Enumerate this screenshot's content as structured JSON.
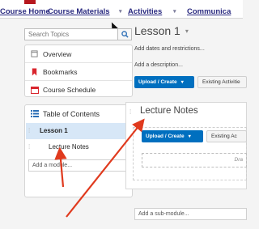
{
  "nav": {
    "items": [
      {
        "label": "Course Home",
        "has_menu": false
      },
      {
        "label": "Course Materials",
        "has_menu": true
      },
      {
        "label": "Activities",
        "has_menu": true
      },
      {
        "label": "Communica",
        "has_menu": false
      }
    ],
    "menu_caret": "▾"
  },
  "sidebar": {
    "search_placeholder": "Search Topics",
    "items": [
      {
        "label": "Overview",
        "icon": "overview-icon"
      },
      {
        "label": "Bookmarks",
        "icon": "bookmark-icon"
      },
      {
        "label": "Course Schedule",
        "icon": "calendar-icon"
      }
    ],
    "toc": {
      "title": "Table of Contents",
      "lesson": "Lesson 1",
      "lecture": "Lecture Notes",
      "add_module_placeholder": "Add a module..."
    }
  },
  "main": {
    "title": "Lesson 1",
    "title_caret": "▾",
    "add_dates": "Add dates and restrictions...",
    "add_description": "Add a description...",
    "upload_label": "Upload / Create",
    "existing_label": "Existing Activitie",
    "dropdown_caret": "▾",
    "card": {
      "title": "Lecture Notes",
      "upload_label": "Upload / Create",
      "existing_label": "Existing Ac",
      "drop_label": "Dra"
    },
    "add_submodule_placeholder": "Add a sub-module..."
  },
  "colors": {
    "accent_blue": "#006fbf",
    "nav_text": "#2a2a80",
    "brand_red": "#b6171e",
    "arrow_red": "#e03a1e",
    "selected_bg": "#d7e7f7"
  }
}
